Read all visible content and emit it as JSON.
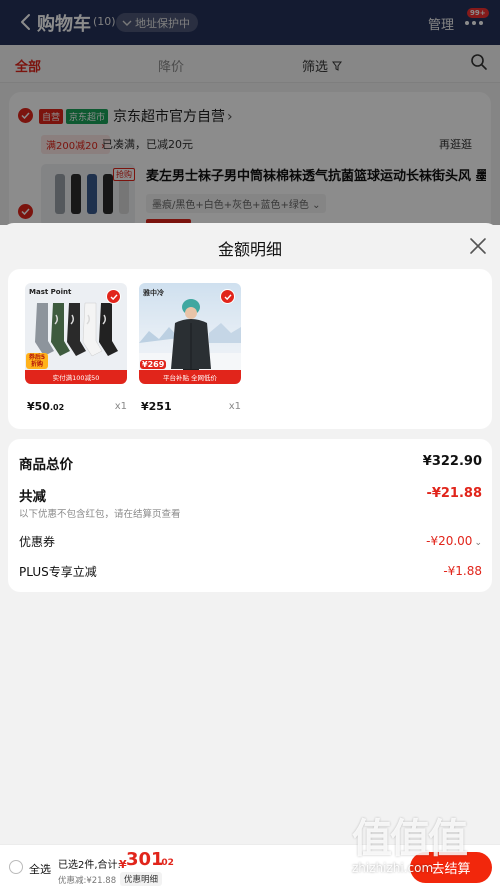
{
  "header": {
    "title": "购物车",
    "count": "(10)",
    "address_status": "地址保护中",
    "manage": "管理",
    "more_badge": "99+"
  },
  "filter_tabs": {
    "all": "全部",
    "price_drop": "降价",
    "filter": "筛选"
  },
  "store": {
    "tag_self": "自营",
    "tag_mart": "京东超市",
    "name": "京东超市官方自营",
    "promo_tag": "满200减20 ›",
    "promo_text": "已凑满，已减20元",
    "go_shop": "再逛逛",
    "product_flag": "抢购",
    "product_title": "麦左男士袜子男中筒袜棉袜透气抗菌篮球运动长袜街头风 墨痕",
    "product_spec": "墨痕/黑色+白色+灰色+蓝色+绿色 ⌄"
  },
  "sheet": {
    "title": "金额明细",
    "products": [
      {
        "brand": "Mast Point",
        "badge": "券后5折购",
        "promo": "实付满100减50",
        "price_int": "¥50",
        "price_dec": ".02",
        "qty": "x1"
      },
      {
        "brand": "雅中冷",
        "badge": "¥269",
        "promo": "平台补贴 全网低价",
        "price_int": "¥251",
        "price_dec": "",
        "qty": "x1"
      }
    ],
    "summary": {
      "total_label": "商品总价",
      "total_value": "¥322.90",
      "reduce_label": "共减",
      "reduce_value": "-¥21.88",
      "reduce_note": "以下优惠不包含红包，请在结算页查看",
      "coupon_label": "优惠券",
      "coupon_value": "-¥20.00",
      "plus_label": "PLUS专享立减",
      "plus_value": "-¥1.88"
    }
  },
  "bottom": {
    "select_all": "全选",
    "selected": "已选2件,合计:",
    "currency": "¥",
    "total_int": "301",
    "total_dec": ".02",
    "discount": "优惠减:¥21.88",
    "detail": "优惠明细",
    "checkout": "去结算"
  },
  "watermark": {
    "glyphs": "值值值",
    "url": "zhizhizhi.com"
  },
  "colors": {
    "accent": "#e1251b",
    "header_bg": "#26325a",
    "checkout": "#f2270c"
  }
}
